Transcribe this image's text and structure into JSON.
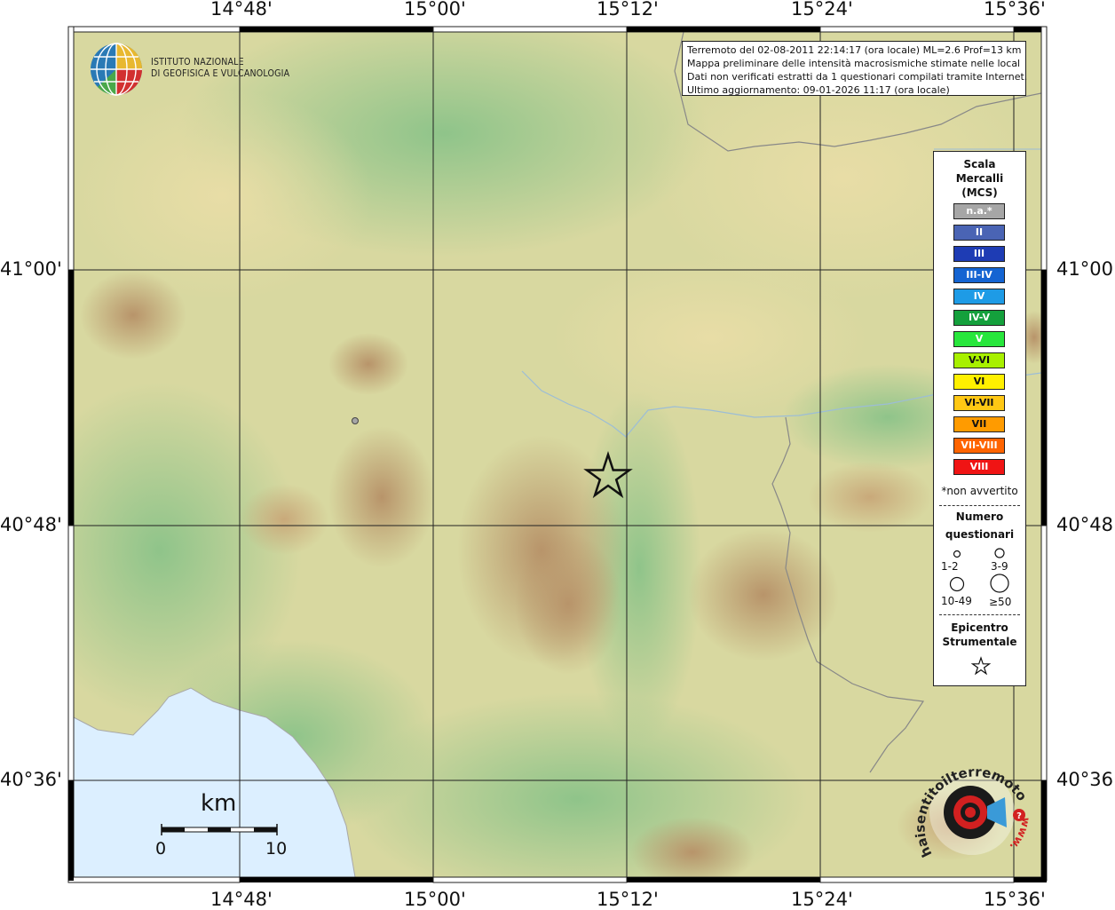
{
  "map": {
    "lon_ticks": [
      "14°48'",
      "15°00'",
      "15°12'",
      "15°24'",
      "15°36'"
    ],
    "lat_ticks": [
      "41°00'",
      "40°48'",
      "40°36'"
    ]
  },
  "info": {
    "line1": "Terremoto del 02-08-2011 22:14:17 (ora locale) ML=2.6 Prof=13 km",
    "line2": "Mappa preliminare delle intensità macrosismiche stimate nelle località",
    "line3": "Dati non verificati estratti da 1 questionari compilati tramite Internet.",
    "line4": "Ultimo aggiornamento: 09-01-2026 11:17 (ora locale)"
  },
  "logo": {
    "line1": "ISTITUTO NAZIONALE",
    "line2": "DI GEOFISICA E VULCANOLOGIA"
  },
  "legend": {
    "title1": "Scala",
    "title2": "Mercalli",
    "title3": "(MCS)",
    "items": [
      {
        "label": "n.a.*",
        "color": "#a6a6a6"
      },
      {
        "label": "II",
        "color": "#4a64b4"
      },
      {
        "label": "III",
        "color": "#1e3cb4"
      },
      {
        "label": "III-IV",
        "color": "#1464d2"
      },
      {
        "label": "IV",
        "color": "#1e9be6"
      },
      {
        "label": "IV-V",
        "color": "#14a03c"
      },
      {
        "label": "V",
        "color": "#28e63c"
      },
      {
        "label": "V-VI",
        "color": "#a8f000"
      },
      {
        "label": "VI",
        "color": "#fff000"
      },
      {
        "label": "VI-VII",
        "color": "#ffc814"
      },
      {
        "label": "VII",
        "color": "#ff9b00"
      },
      {
        "label": "VII-VIII",
        "color": "#ff6400"
      },
      {
        "label": "VIII",
        "color": "#f01414"
      }
    ],
    "note": "*non avvertito",
    "questionnaire_title1": "Numero",
    "questionnaire_title2": "questionari",
    "q_labels": [
      "1-2",
      "3-9",
      "10-49",
      "≥50"
    ],
    "epicenter_title1": "Epicentro",
    "epicenter_title2": "Strumentale"
  },
  "scalebar": {
    "unit": "km",
    "start": "0",
    "end": "10"
  },
  "site_logo": {
    "text": "haisentitoilterremoto.it",
    "url_text": "www."
  }
}
